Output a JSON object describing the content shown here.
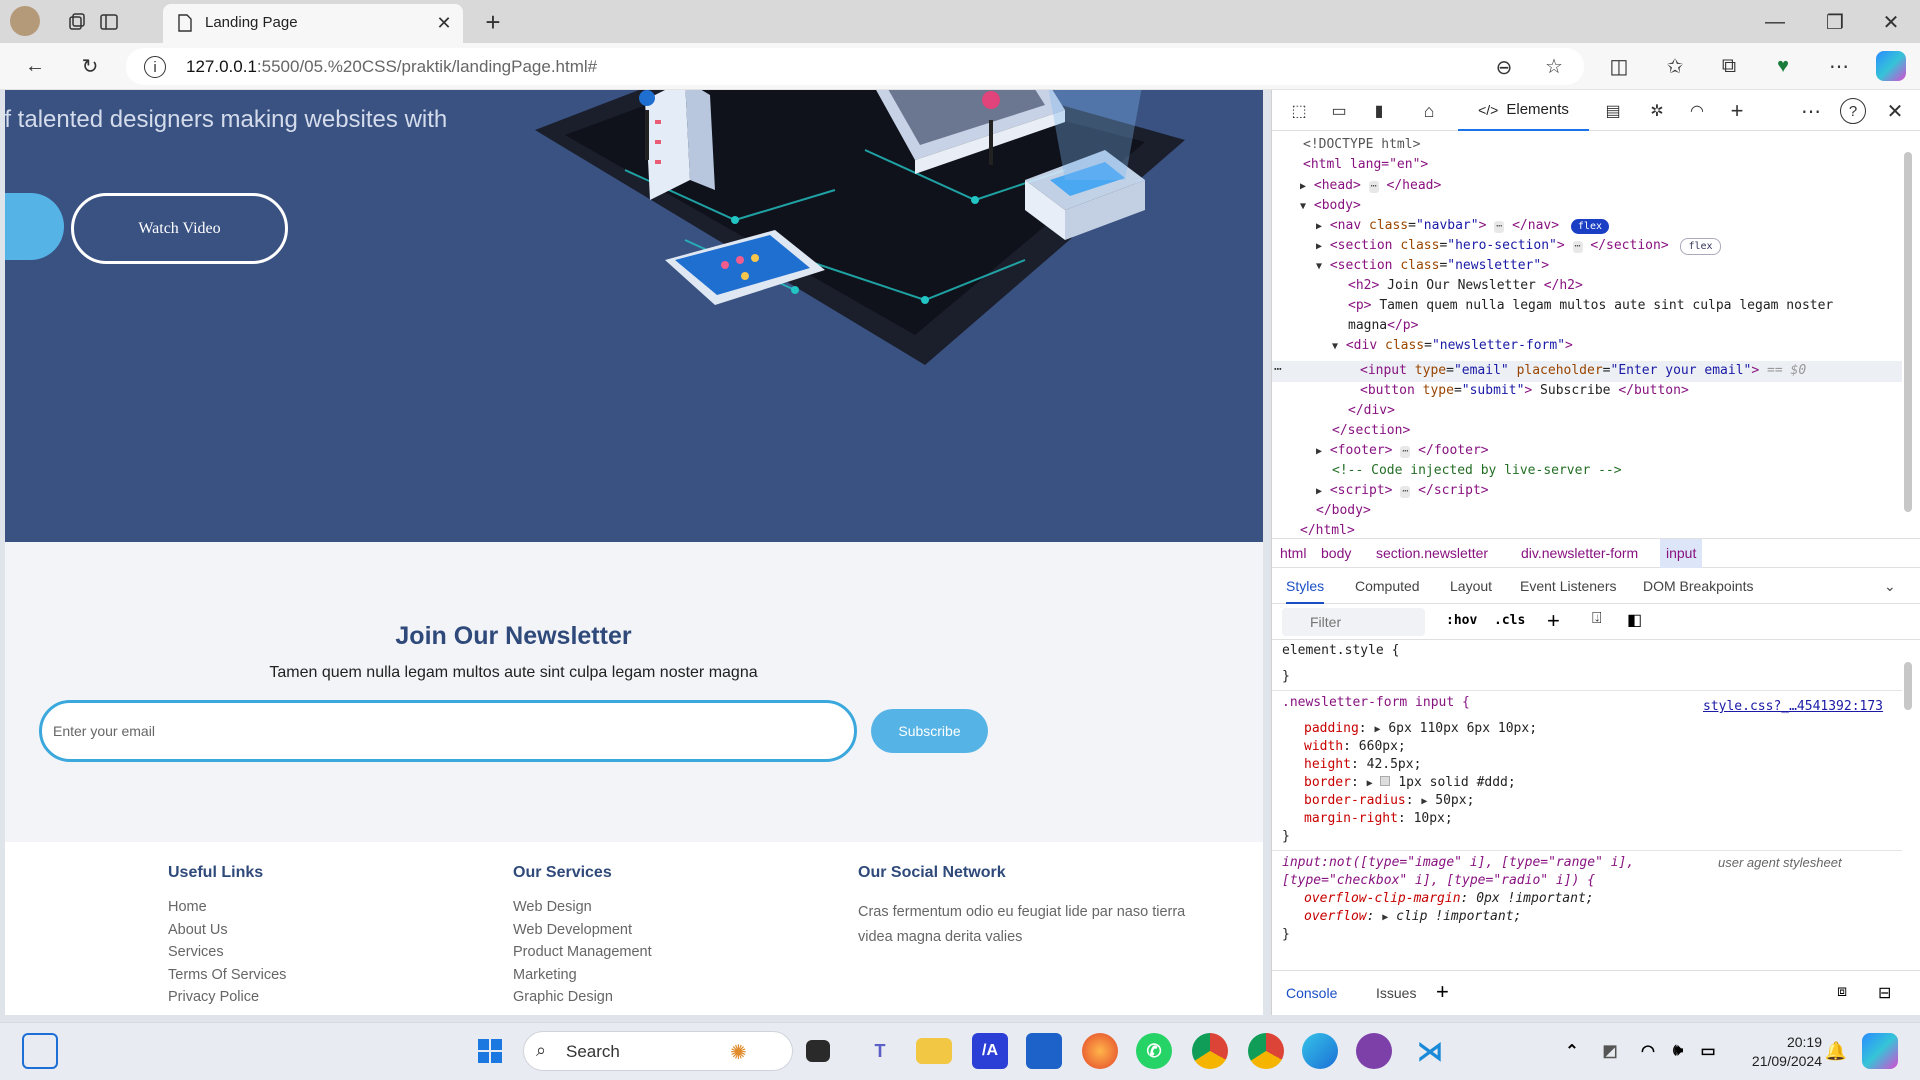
{
  "browser": {
    "tab_title": "Landing Page",
    "url_host": "127.0.0.1",
    "url_rest": ":5500/05.%20CSS/praktik/landingPage.html#"
  },
  "hero": {
    "text": "of talented designers making websites with",
    "watch_button": "Watch Video"
  },
  "newsletter": {
    "title": "Join Our Newsletter",
    "description": "Tamen quem nulla legam multos aute sint culpa legam noster magna",
    "input_placeholder": "Enter your email",
    "button": "Subscribe"
  },
  "footer": {
    "columns": [
      {
        "title": "Useful Links",
        "items": [
          "Home",
          "About Us",
          "Services",
          "Terms Of Services",
          "Privacy Police"
        ]
      },
      {
        "title": "Our Services",
        "items": [
          "Web Design",
          "Web Development",
          "Product Management",
          "Marketing",
          "Graphic Design"
        ]
      },
      {
        "title": "Our Social Network",
        "text": "Cras fermentum odio eu feugiat lide par naso tierra videa magna derita valies"
      }
    ]
  },
  "devtools": {
    "tab_elements": "Elements",
    "dom_lines": {
      "doctype": "<!DOCTYPE html>",
      "html_open": "<html lang=\"en\">",
      "head": "head",
      "body": "body",
      "nav_class": "navbar",
      "hero_class": "hero-section",
      "newsletter_class": "newsletter",
      "h2_text": "Join Our Newsletter",
      "p_text": "Tamen quem nulla legam multos aute sint culpa legam noster",
      "p_text2": "magna",
      "div_class": "newsletter-form",
      "input_type": "email",
      "input_placeholder": "Enter your email",
      "selected_marker": "== $0",
      "button_type": "submit",
      "button_text": "Subscribe",
      "comment": "<!-- Code injected by live-server -->",
      "badge_flex": "flex"
    },
    "breadcrumbs": [
      "html",
      "body",
      "section.newsletter",
      "div.newsletter-form",
      "input"
    ],
    "style_tabs": [
      "Styles",
      "Computed",
      "Layout",
      "Event Listeners",
      "DOM Breakpoints"
    ],
    "filter_placeholder": "Filter",
    "hov": ":hov",
    "cls": ".cls",
    "styles": {
      "element_style": "element.style {",
      "rule1_selector": ".newsletter-form input {",
      "rule1_source": "style.css?_…4541392:173",
      "props": [
        {
          "name": "padding",
          "value": "6px 110px 6px 10px;"
        },
        {
          "name": "width",
          "value": "660px;"
        },
        {
          "name": "height",
          "value": "42.5px;"
        },
        {
          "name": "border",
          "value": "1px solid #ddd;"
        },
        {
          "name": "border-radius",
          "value": "50px;"
        },
        {
          "name": "margin-right",
          "value": "10px;"
        }
      ],
      "ua_selector_1": "input:not([type=\"image\" i], [type=\"range\" i],",
      "ua_selector_2": "[type=\"checkbox\" i], [type=\"radio\" i]) {",
      "ua_source": "user agent stylesheet",
      "ua_props": [
        {
          "name": "overflow-clip-margin",
          "value": "0px !important;"
        },
        {
          "name": "overflow",
          "value": "clip !important;"
        }
      ]
    },
    "console_tabs": [
      "Console",
      "Issues"
    ]
  },
  "taskbar": {
    "search": "Search",
    "time": "20:19",
    "date": "21/09/2024"
  }
}
